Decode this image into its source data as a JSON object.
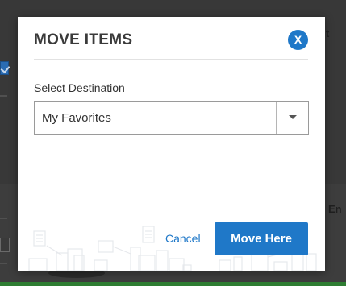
{
  "background": {
    "partial_text_right_top": "t",
    "partial_text_right_bottom": "En"
  },
  "modal": {
    "title": "MOVE ITEMS",
    "close_label": "X",
    "field_label": "Select Destination",
    "select": {
      "value": "My Favorites"
    },
    "cancel_label": "Cancel",
    "primary_label": "Move Here"
  },
  "colors": {
    "accent": "#1f78c8",
    "title_text": "#3a3a3a",
    "overlay": "#3a3a3a"
  }
}
